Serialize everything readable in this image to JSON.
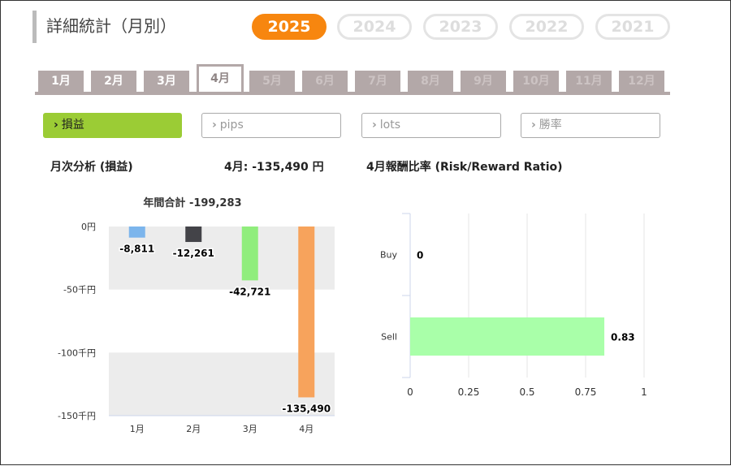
{
  "page_title": "詳細統計（月別）",
  "years": [
    {
      "label": "2025",
      "active": true
    },
    {
      "label": "2024",
      "active": false
    },
    {
      "label": "2023",
      "active": false
    },
    {
      "label": "2022",
      "active": false
    },
    {
      "label": "2021",
      "active": false
    }
  ],
  "months": [
    {
      "label": "1月",
      "state": "past"
    },
    {
      "label": "2月",
      "state": "past"
    },
    {
      "label": "3月",
      "state": "past"
    },
    {
      "label": "4月",
      "state": "active"
    },
    {
      "label": "5月",
      "state": "future"
    },
    {
      "label": "6月",
      "state": "future"
    },
    {
      "label": "7月",
      "state": "future"
    },
    {
      "label": "8月",
      "state": "future"
    },
    {
      "label": "9月",
      "state": "future"
    },
    {
      "label": "10月",
      "state": "future"
    },
    {
      "label": "11月",
      "state": "future"
    },
    {
      "label": "12月",
      "state": "future"
    }
  ],
  "metrics": [
    {
      "label": "損益",
      "active": true
    },
    {
      "label": "pips",
      "active": false
    },
    {
      "label": "lots",
      "active": false
    },
    {
      "label": "勝率",
      "active": false
    }
  ],
  "colors": {
    "accent_year": "#f7860f",
    "month_tab": "#b3a8a8",
    "metric_active": "#9bcc35"
  },
  "left_panel": {
    "heading": "月次分析 (損益)",
    "month_summary": "4月:  -135,490 円"
  },
  "right_panel": {
    "heading": "4月報酬比率 (Risk/Reward Ratio)"
  },
  "chart_data": [
    {
      "type": "bar",
      "title": "年間合計 -199,283",
      "categories": [
        "1月",
        "2月",
        "3月",
        "4月"
      ],
      "values": [
        -8811,
        -12261,
        -42721,
        -135490
      ],
      "value_labels": [
        "-8,811",
        "-12,261",
        "-42,721",
        "-135,490"
      ],
      "colors": [
        "#7cb5ec",
        "#434348",
        "#90ed7d",
        "#f7a35c"
      ],
      "ylim": [
        -150000,
        0
      ],
      "yticks": [
        {
          "value": 0,
          "label": "0円"
        },
        {
          "value": -50000,
          "label": "-50千円"
        },
        {
          "value": -100000,
          "label": "-100千円"
        },
        {
          "value": -150000,
          "label": "-150千円"
        }
      ],
      "grid": "alternating bands"
    },
    {
      "type": "bar",
      "orientation": "horizontal",
      "categories": [
        "Buy",
        "Sell"
      ],
      "values": [
        0,
        0.83
      ],
      "value_labels": [
        "0",
        "0.83"
      ],
      "color": "#a9ffa9",
      "xlim": [
        0,
        1
      ],
      "xticks": [
        {
          "value": 0,
          "label": "0"
        },
        {
          "value": 0.25,
          "label": "0.25"
        },
        {
          "value": 0.5,
          "label": "0.5"
        },
        {
          "value": 0.75,
          "label": "0.75"
        },
        {
          "value": 1,
          "label": "1"
        }
      ],
      "grid": "vertical lines"
    }
  ]
}
